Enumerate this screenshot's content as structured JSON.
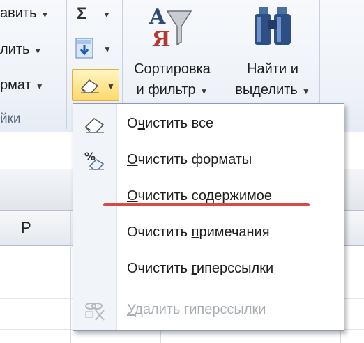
{
  "ribbon": {
    "cells_group": {
      "insert_label": "авить",
      "delete_label": "лить",
      "format_label": "рмат",
      "group_label": "йки"
    },
    "editing": {
      "sort_label_line1": "Сортировка",
      "sort_label_line2": "и фильтр",
      "find_label_line1": "Найти и",
      "find_label_line2": "выделить"
    }
  },
  "sheet": {
    "column_letter": "P"
  },
  "clear_menu": {
    "items": [
      {
        "pre": "О",
        "key": "ч",
        "post": "истить все",
        "icon": "eraser-icon",
        "enabled": true
      },
      {
        "pre": "",
        "key": "О",
        "post": "чистить форматы",
        "icon": "clear-formats-icon",
        "enabled": true
      },
      {
        "pre": "",
        "key": "О",
        "post": "чистить содержимое",
        "icon": "none",
        "enabled": true
      },
      {
        "pre": "Очистить ",
        "key": "п",
        "post": "римечания",
        "icon": "none",
        "enabled": true
      },
      {
        "pre": "Очистить ",
        "key": "г",
        "post": "иперссылки",
        "icon": "none",
        "enabled": true
      },
      {
        "pre": "",
        "key": "У",
        "post": "далить гиперссылки",
        "icon": "remove-hyperlinks-icon",
        "enabled": false
      }
    ]
  },
  "colors": {
    "highlight_underline": "#d64a48",
    "active_button": "#ffd86a"
  }
}
